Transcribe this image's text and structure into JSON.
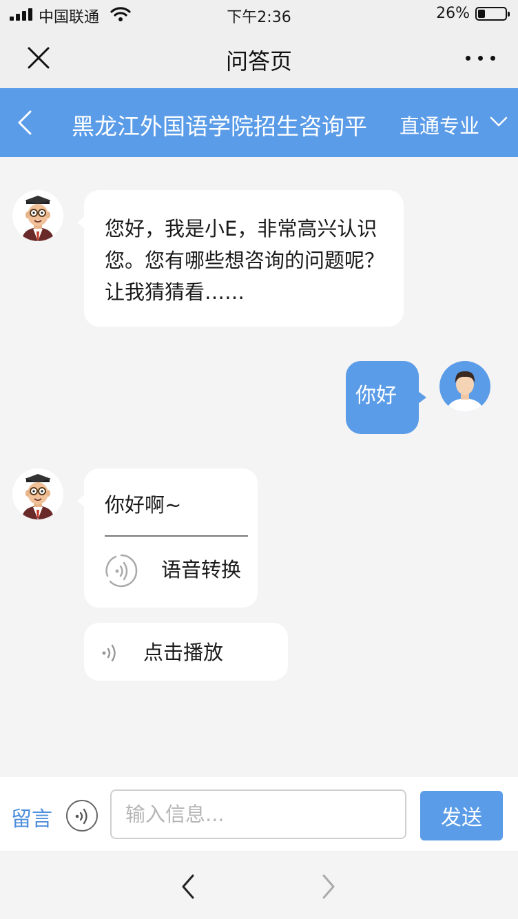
{
  "status_bar": {
    "carrier": "中国联通",
    "time": "下午2:36",
    "battery_percent": "26%",
    "battery_level": 0.26,
    "icons": [
      "signal-icon",
      "wifi-icon",
      "battery-icon"
    ]
  },
  "nav": {
    "title": "问答页",
    "close_icon": "close-icon",
    "more_icon": "more-icon"
  },
  "header": {
    "title": "黑龙江外国语学院招生咨询平",
    "direct_label": "直通专业",
    "back_icon": "chevron-left-icon",
    "dropdown_icon": "chevron-down-icon",
    "color": "#5b9ce8"
  },
  "messages": {
    "m1": {
      "sender": "bot",
      "text": "您好，我是小E，非常高兴认识您。您有哪些想咨询的问题呢？让我猜猜看……"
    },
    "m2": {
      "sender": "user",
      "text": "你好"
    },
    "m3": {
      "sender": "bot",
      "text": "你好啊~",
      "voice_convert_label": "语音转换",
      "voice_icon": "voice-convert-icon"
    },
    "m4": {
      "sender": "bot",
      "play_label": "点击播放",
      "icon": "sound-wave-icon"
    }
  },
  "input_bar": {
    "leave_message": "留言",
    "placeholder": "输入信息...",
    "send_label": "发送",
    "voice_icon": "microphone-wave-icon"
  },
  "browser_nav": {
    "back_icon": "chevron-left-icon",
    "forward_icon": "chevron-right-icon"
  },
  "colors": {
    "accent": "#5b9ce8",
    "link": "#4d8fdc",
    "background": "#f4f4f4"
  }
}
